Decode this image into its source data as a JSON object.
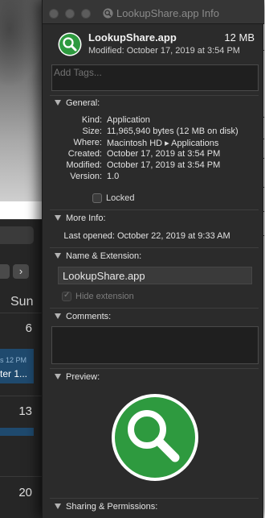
{
  "calendar": {
    "next_glyph": "›",
    "day_header": "Sun",
    "dates": [
      "6",
      "13",
      "20"
    ],
    "event_time": "s 12 PM",
    "event_title": "ter 1..."
  },
  "window": {
    "title": "LookupShare.app Info"
  },
  "header": {
    "name": "LookupShare.app",
    "size": "12 MB",
    "modified": "Modified: October 17, 2019 at 3:54 PM"
  },
  "tags": {
    "placeholder": "Add Tags..."
  },
  "general": {
    "title": "General:",
    "rows": [
      {
        "label": "Kind:",
        "value": "Application"
      },
      {
        "label": "Size:",
        "value": "11,965,940 bytes (12 MB on disk)"
      },
      {
        "label": "Where:",
        "value": "Macintosh HD ▸ Applications"
      },
      {
        "label": "Created:",
        "value": "October 17, 2019 at 3:54 PM"
      },
      {
        "label": "Modified:",
        "value": "October 17, 2019 at 3:54 PM"
      },
      {
        "label": "Version:",
        "value": "1.0"
      }
    ],
    "locked_label": "Locked"
  },
  "more_info": {
    "title": "More Info:",
    "last_opened_label": "Last opened:",
    "last_opened_value": "October 22, 2019 at 9:33 AM"
  },
  "name_ext": {
    "title": "Name & Extension:",
    "value": "LookupShare.app",
    "hide_label": "Hide extension"
  },
  "comments": {
    "title": "Comments:"
  },
  "preview": {
    "title": "Preview:"
  },
  "sharing": {
    "title": "Sharing & Permissions:"
  },
  "colors": {
    "icon_green": "#2e9a3f",
    "icon_white": "#ffffff",
    "window_bg": "#2b2b2b",
    "calendar_event": "#1f4a6e"
  },
  "icons": [
    "magnifier-icon",
    "disclosure-triangle-icon",
    "checkbox-icon"
  ]
}
